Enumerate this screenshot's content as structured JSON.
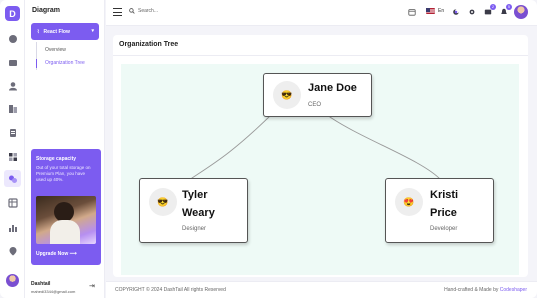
{
  "app": {
    "logo_letter": "D",
    "brand_color": "#7c5cf0"
  },
  "sidebar": {
    "title": "Diagram",
    "group_button": "React Flow",
    "items": [
      {
        "label": "Overview",
        "active": false
      },
      {
        "label": "Organization Tree",
        "active": true
      }
    ],
    "storage": {
      "title": "Storage capacity",
      "text": "Out of your total storage on Premium Plan, you have used up 40%.",
      "used_percent": 40,
      "cta": "Upgrade Now"
    },
    "user": {
      "name": "Dashtail",
      "email": "mahedi3344@gmail.com"
    }
  },
  "header": {
    "search_placeholder": "Search...",
    "language": "En",
    "icons": [
      "calendar-icon",
      "flag-us-icon",
      "theme-icon",
      "settings-icon",
      "message-icon",
      "notification-icon"
    ],
    "message_count": "2",
    "notification_count": "5"
  },
  "card": {
    "title": "Organization Tree"
  },
  "org_tree": {
    "edge_color": "#9a9a9a",
    "nodes": [
      {
        "name": "Jane Doe",
        "role": "CEO",
        "face": "😎"
      },
      {
        "name": "Tyler Weary",
        "role": "Designer",
        "face": "😎"
      },
      {
        "name": "Kristi Price",
        "role": "Developer",
        "face": "😍"
      }
    ]
  },
  "footer": {
    "copyright": "COPYRIGHT © 2024 DashTail All rights Reserved",
    "credit_prefix": "Hand-crafted & Made by",
    "credit_link": "Codeshaper"
  }
}
